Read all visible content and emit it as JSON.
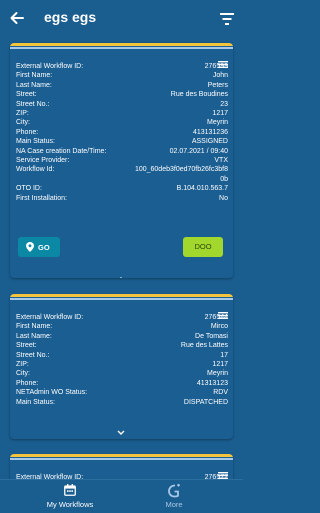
{
  "header": {
    "title": "egs egs"
  },
  "cards": [
    {
      "rows": [
        {
          "label": "External Workflow ID:",
          "value": "276599"
        },
        {
          "label": "First Name:",
          "value": "John"
        },
        {
          "label": "Last Name:",
          "value": "Peters"
        },
        {
          "label": "Street:",
          "value": "Rue des Boudines"
        },
        {
          "label": "Street No.:",
          "value": "23"
        },
        {
          "label": "ZIP:",
          "value": "1217"
        },
        {
          "label": "City:",
          "value": "Meyrin"
        },
        {
          "label": "Phone:",
          "value": "413131236"
        },
        {
          "label": "Main Status:",
          "value": "ASSIGNED"
        },
        {
          "label": "NA Case creation Date/Time:",
          "value": "02.07.2021 / 09:40"
        },
        {
          "label": "Service Provider:",
          "value": "VTX"
        },
        {
          "label": "Workflow Id:",
          "value": "100_60deb3f0ed70fb26fc3bf80b"
        },
        {
          "label": "OTO ID:",
          "value": "B.104.010.563.7"
        },
        {
          "label": "First Installation:",
          "value": "No"
        }
      ],
      "go_label": "GO",
      "doo_label": "DOO"
    },
    {
      "rows": [
        {
          "label": "External Workflow ID:",
          "value": "276544"
        },
        {
          "label": "First Name:",
          "value": "Mirco"
        },
        {
          "label": "Last Name:",
          "value": "De Tomasi"
        },
        {
          "label": "Street:",
          "value": "Rue des Lattes"
        },
        {
          "label": "Street No.:",
          "value": "17"
        },
        {
          "label": "ZIP:",
          "value": "1217"
        },
        {
          "label": "City:",
          "value": "Meyrin"
        },
        {
          "label": "Phone:",
          "value": "41313123"
        },
        {
          "label": "NETAdmin WO Status:",
          "value": "RDV"
        },
        {
          "label": "Main Status:",
          "value": "DISPATCHED"
        }
      ]
    },
    {
      "rows": [
        {
          "label": "External Workflow ID:",
          "value": "276577"
        }
      ]
    }
  ],
  "bottom_nav": {
    "workflows_label": "My Workflows",
    "more_label": "More"
  },
  "colors": {
    "background": "#1a5d8f",
    "accent_yellow": "#f3c43c",
    "go_button": "#0b88a4",
    "doo_button": "#a2d72e"
  }
}
